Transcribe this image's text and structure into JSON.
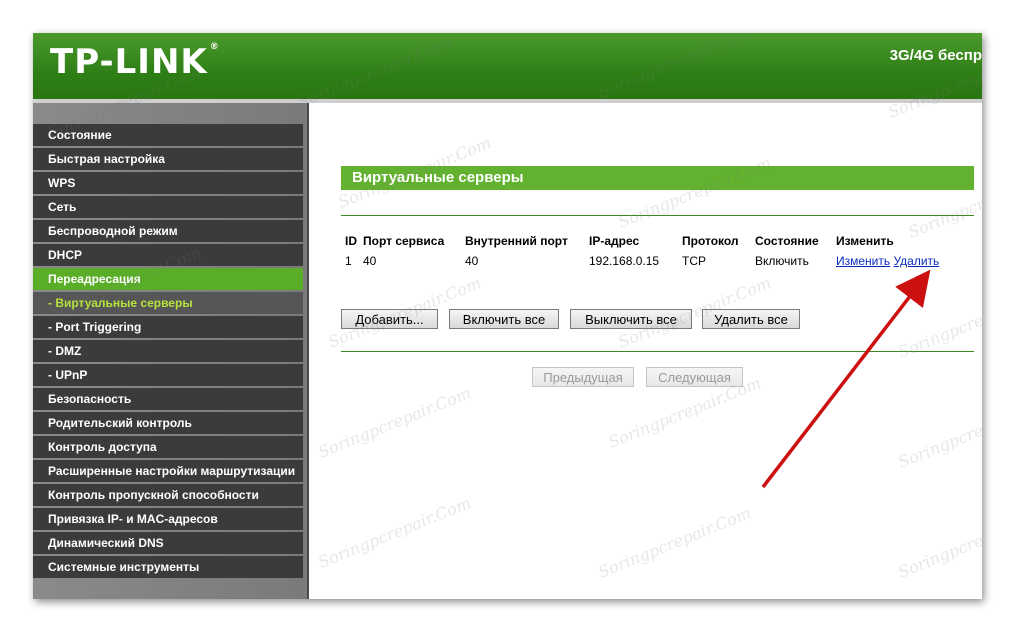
{
  "header": {
    "logo": "TP-LINK",
    "logo_mark": "®",
    "title": "3G/4G беспр"
  },
  "sidebar": {
    "items": [
      {
        "label": "Состояние",
        "type": "main"
      },
      {
        "label": "Быстрая настройка",
        "type": "main"
      },
      {
        "label": "WPS",
        "type": "main"
      },
      {
        "label": "Сеть",
        "type": "main"
      },
      {
        "label": "Беспроводной режим",
        "type": "main"
      },
      {
        "label": "DHCP",
        "type": "main"
      },
      {
        "label": "Переадресация",
        "type": "active"
      },
      {
        "label": "- Виртуальные серверы",
        "type": "current"
      },
      {
        "label": "- Port Triggering",
        "type": "sub"
      },
      {
        "label": "- DMZ",
        "type": "sub"
      },
      {
        "label": "- UPnP",
        "type": "sub"
      },
      {
        "label": "Безопасность",
        "type": "main"
      },
      {
        "label": "Родительский контроль",
        "type": "main"
      },
      {
        "label": "Контроль доступа",
        "type": "main"
      },
      {
        "label": "Расширенные настройки маршрутизации",
        "type": "main"
      },
      {
        "label": "Контроль пропускной способности",
        "type": "main"
      },
      {
        "label": "Привязка IP- и MAC-адресов",
        "type": "main"
      },
      {
        "label": "Динамический DNS",
        "type": "main"
      },
      {
        "label": "Системные инструменты",
        "type": "main"
      }
    ]
  },
  "main": {
    "section_title": "Виртуальные серверы",
    "table": {
      "headers": [
        "ID",
        "Порт сервиса",
        "Внутренний порт",
        "IP-адрес",
        "Протокол",
        "Состояние",
        "Изменить"
      ],
      "rows": [
        {
          "id": "1",
          "service_port": "40",
          "internal_port": "40",
          "ip": "192.168.0.15",
          "protocol": "TCP",
          "status": "Включить",
          "edit": "Изменить",
          "delete": "Удалить"
        }
      ]
    },
    "buttons": {
      "add": "Добавить...",
      "enable_all": "Включить все",
      "disable_all": "Выключить все",
      "delete_all": "Удалить все",
      "prev": "Предыдущая",
      "next": "Следующая"
    }
  },
  "watermark_text": "Soringpcrepair.Com",
  "colors": {
    "header_green": "#2e7f16",
    "accent_green": "#62b22f",
    "menu_dark": "#3b3b3b",
    "current_item_text": "#b9e33c",
    "arrow_red": "#cc1010",
    "link_blue": "#0b2dbd"
  }
}
